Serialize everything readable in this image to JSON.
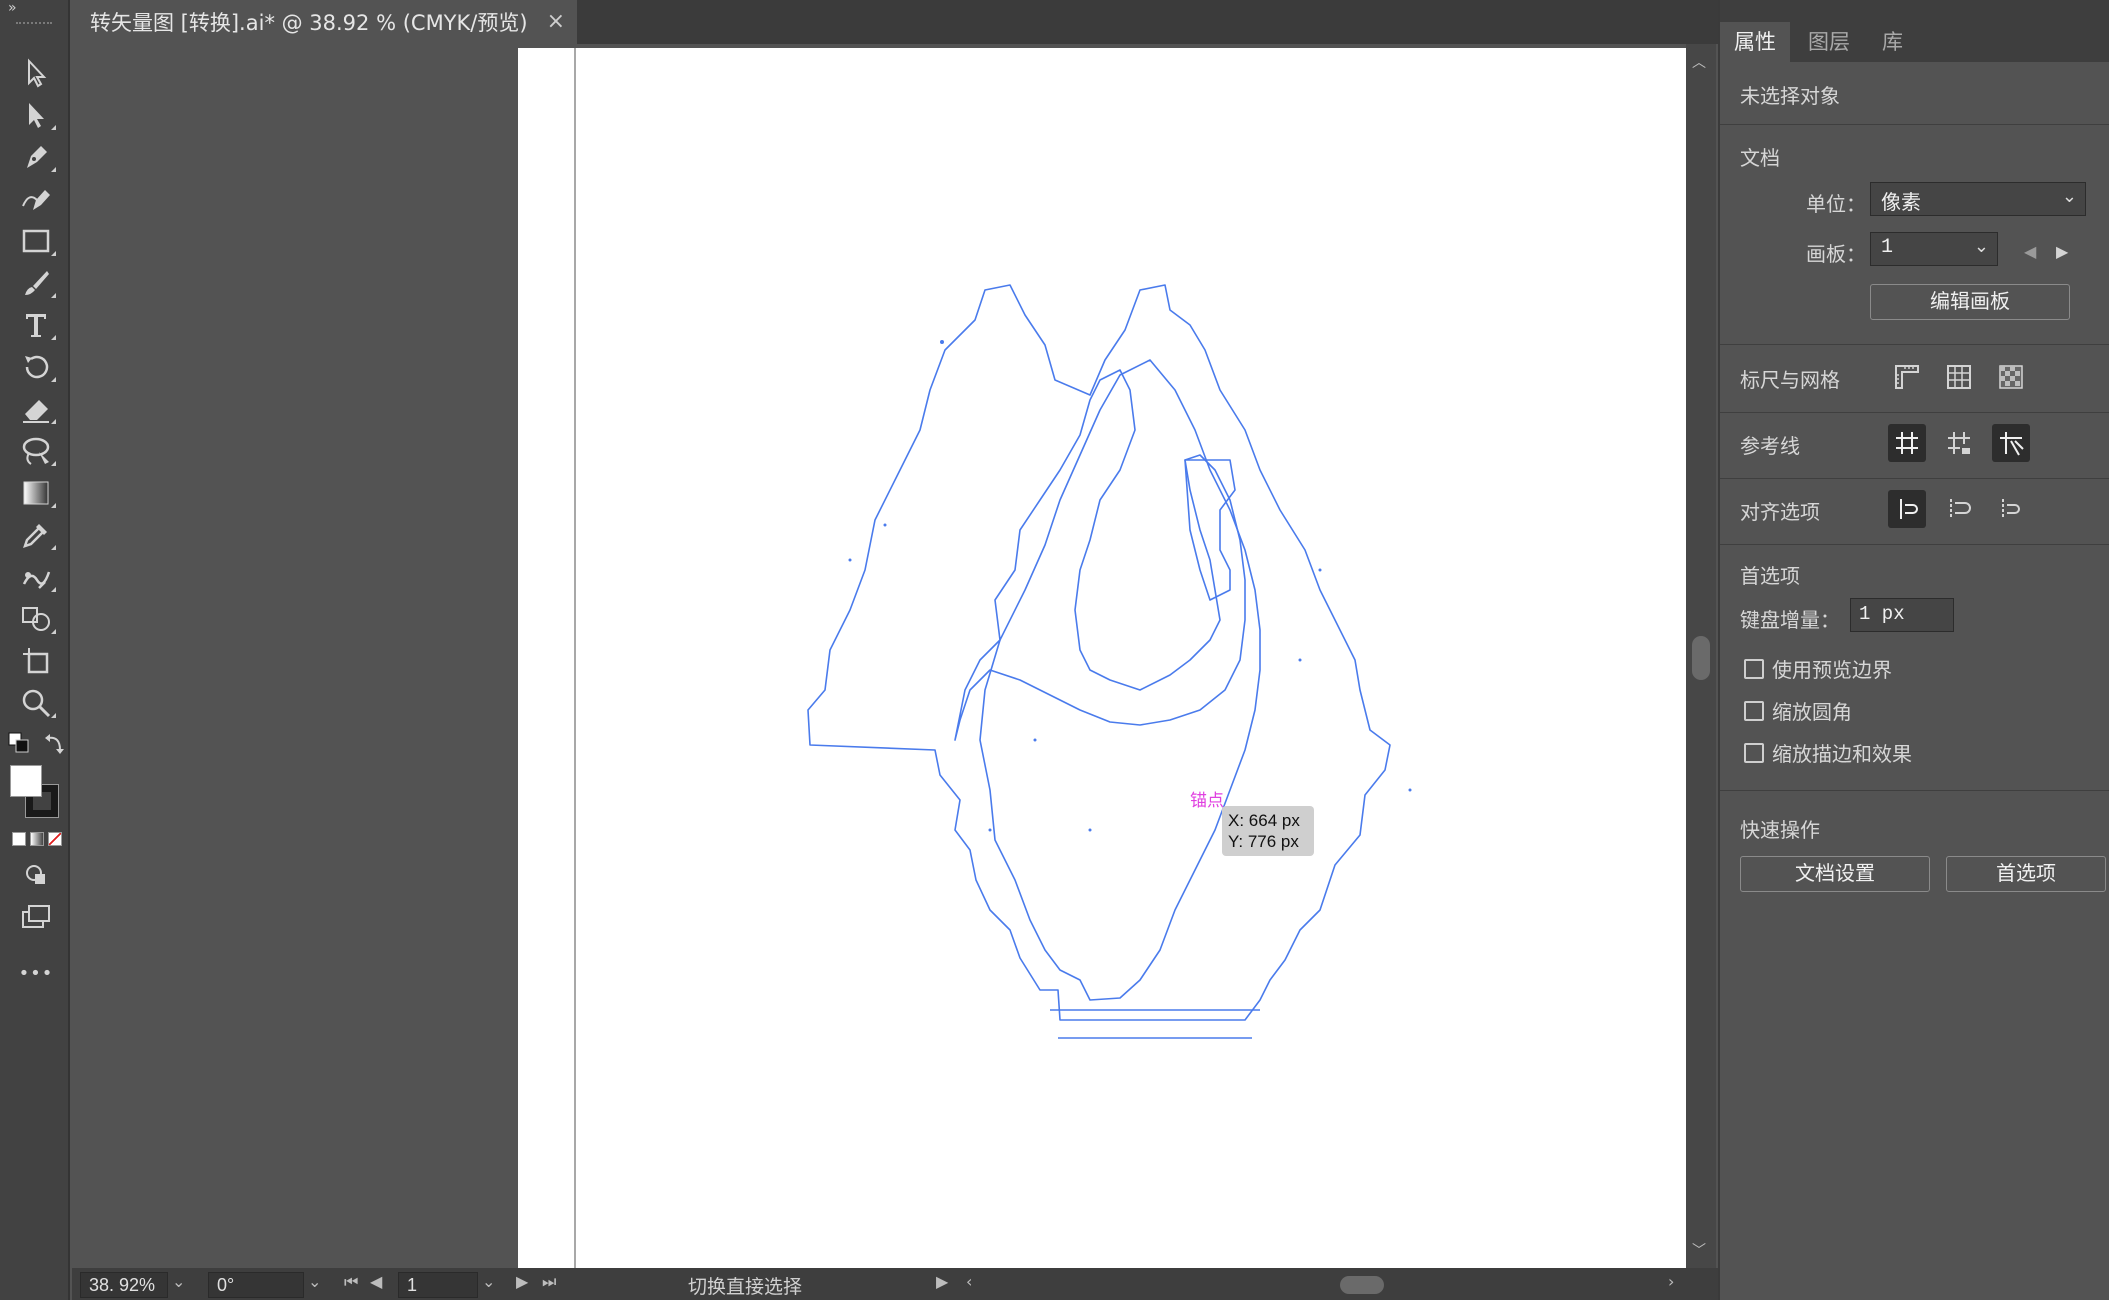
{
  "document_tab": {
    "title": "转矢量图 [转换].ai* @ 38.92 % (CMYK/预览)",
    "close": "×"
  },
  "toolbar": {
    "collapse": "»",
    "tools": [
      {
        "name": "selection-tool",
        "icon": "arrow-outline-icon"
      },
      {
        "name": "direct-selection-tool",
        "icon": "arrow-solid-icon"
      },
      {
        "name": "pen-tool",
        "icon": "pen-icon"
      },
      {
        "name": "curvature-tool",
        "icon": "curvature-pen-icon"
      },
      {
        "name": "rectangle-tool",
        "icon": "rectangle-icon"
      },
      {
        "name": "paintbrush-tool",
        "icon": "brush-icon"
      },
      {
        "name": "type-tool",
        "icon": "type-icon"
      },
      {
        "name": "rotate-tool",
        "icon": "rotate-icon"
      },
      {
        "name": "eraser-tool",
        "icon": "eraser-icon"
      },
      {
        "name": "lasso-tool",
        "icon": "lasso-icon"
      },
      {
        "name": "gradient-tool",
        "icon": "gradient-icon"
      },
      {
        "name": "eyedropper-tool",
        "icon": "eyedropper-icon"
      },
      {
        "name": "puppet-warp-tool",
        "icon": "puppet-warp-icon"
      },
      {
        "name": "shape-builder-tool",
        "icon": "shape-builder-icon"
      },
      {
        "name": "artboard-tool",
        "icon": "artboard-icon"
      },
      {
        "name": "zoom-tool",
        "icon": "zoom-icon"
      }
    ],
    "more": "•••",
    "fill_color": "#ffffff",
    "stroke_color": "#1a1a1a"
  },
  "canvas": {
    "artboard_bg": "#ffffff",
    "path_color": "#4a7bec",
    "anchor_label": "锚点",
    "coord_x": "X: 664 px",
    "coord_y": "Y: 776 px"
  },
  "statusbar": {
    "zoom": "38. 92%",
    "rotation": "0°",
    "artboard_num": "1",
    "status_text": "切换直接选择"
  },
  "panel": {
    "tabs": [
      "属性",
      "图层",
      "库"
    ],
    "no_selection": "未选择对象",
    "document_heading": "文档",
    "units_label": "单位：",
    "units_value": "像素",
    "artboard_label": "画板：",
    "artboard_value": "1",
    "edit_artboards_button": "编辑画板",
    "rulers_grids_label": "标尺与网格",
    "guides_label": "参考线",
    "align_label": "对齐选项",
    "preferences_heading": "首选项",
    "keyboard_increment_label": "键盘增量：",
    "keyboard_increment_value": "1 px",
    "checkboxes": [
      "使用预览边界",
      "缩放圆角",
      "缩放描边和效果"
    ],
    "quick_actions_heading": "快速操作",
    "document_setup_button": "文档设置",
    "preferences_button": "首选项"
  }
}
